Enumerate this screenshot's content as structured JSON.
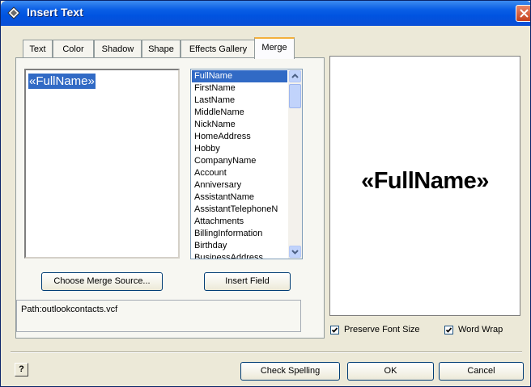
{
  "window": {
    "title": "Insert Text"
  },
  "tabs": [
    {
      "label": "Text"
    },
    {
      "label": "Color"
    },
    {
      "label": "Shadow"
    },
    {
      "label": "Shape"
    },
    {
      "label": "Effects Gallery"
    },
    {
      "label": "Merge"
    }
  ],
  "active_tab": "Merge",
  "text_input": {
    "value": "«FullName»"
  },
  "field_list": {
    "selected": "FullName",
    "items": [
      "FullName",
      "FirstName",
      "LastName",
      "MiddleName",
      "NickName",
      "HomeAddress",
      "Hobby",
      "CompanyName",
      "Account",
      "Anniversary",
      "AssistantName",
      "AssistantTelephoneN",
      "Attachments",
      "BillingInformation",
      "Birthday",
      "BusinessAddress"
    ]
  },
  "buttons": {
    "choose_merge_source": "Choose Merge Source...",
    "insert_field": "Insert Field",
    "check_spelling": "Check Spelling",
    "ok": "OK",
    "cancel": "Cancel",
    "help": "?"
  },
  "path": {
    "text": "Path:outlookcontacts.vcf"
  },
  "preview": {
    "text": "«FullName»"
  },
  "options": {
    "preserve_font_size": {
      "label": "Preserve Font Size",
      "checked": true
    },
    "word_wrap": {
      "label": "Word Wrap",
      "checked": true
    }
  },
  "colors": {
    "titlebar": "#0053e0",
    "dialog_bg": "#ece9d8",
    "selection": "#316ac5",
    "active_tab_accent": "#f3b03c",
    "close_button": "#c4411e"
  }
}
